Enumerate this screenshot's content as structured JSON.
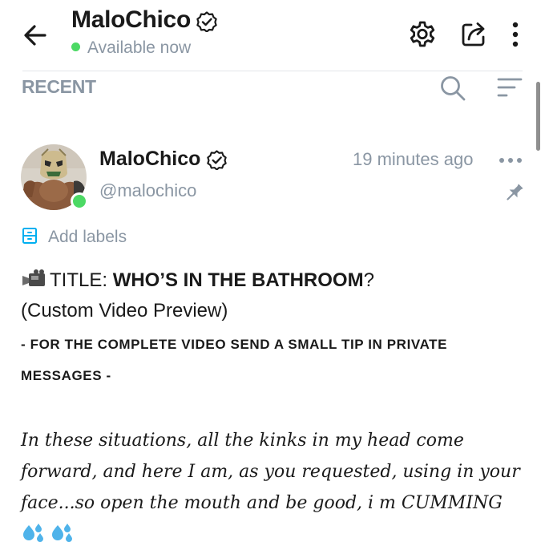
{
  "header": {
    "name": "MaloChico",
    "status": "Available now",
    "status_color": "#4cd964",
    "icons": [
      "back-arrow-icon",
      "verified-icon",
      "settings-icon",
      "share-icon",
      "more-vertical-icon"
    ]
  },
  "filter": {
    "label": "RECENT",
    "icons": [
      "search-icon",
      "sort-icon"
    ]
  },
  "post": {
    "author_name": "MaloChico",
    "handle": "@malochico",
    "time": "19 minutes ago",
    "add_labels": "Add labels",
    "title_prefix": "TITLE: ",
    "title": "WHO’S IN THE BATHROOM",
    "title_suffix": "?",
    "subtitle": "(Custom Video Preview)",
    "notice": "- FOR THE COMPLETE VIDEO SEND A SMALL TIP IN PRIVATE MESSAGES -",
    "body": "In these situations, all the kinks in my head come forward, and here I am, as you requested, using in your face...so open the mouth and be good, i m CUMMING"
  },
  "colors": {
    "accent": "#00aff0",
    "muted": "#8a96a3",
    "text": "#1a1a1a"
  }
}
